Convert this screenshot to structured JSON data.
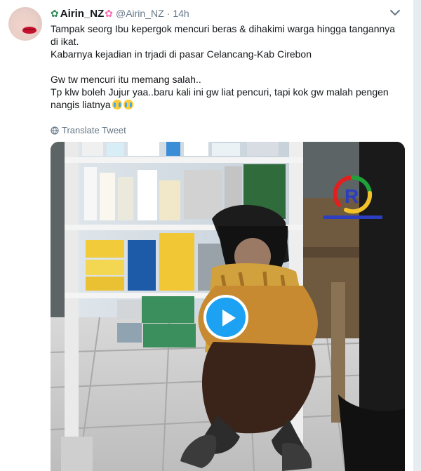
{
  "tweet": {
    "display_name": "Airin_NZ",
    "handle": "@Airin_NZ",
    "dot": "·",
    "time": "14h",
    "text_lines": [
      "Tampak seorg Ibu kepergok mencuri beras & dihakimi warga hingga tangannya",
      "di ikat.",
      "Kabarnya kejadian in trjadi di pasar Celancang-Kab Cirebon",
      "",
      "Gw tw mencuri itu memang salah..",
      "Tp klw boleh Jujur yaa..baru kali ini gw liat pencuri, tapi kok gw malah pengen",
      "nangis liatnya"
    ],
    "translate_label": "Translate Tweet",
    "name_emoji_left": "flower-icon",
    "name_emoji_right": "cherry-blossom-icon",
    "text_trailing_emojis": [
      "crying-face-icon",
      "crying-face-icon"
    ]
  },
  "video": {
    "watermark": "R",
    "accent_color": "#1da1f2"
  },
  "colors": {
    "primary_text": "#14171a",
    "secondary_text": "#657786",
    "background": "#e6ecf0",
    "card": "#ffffff"
  }
}
